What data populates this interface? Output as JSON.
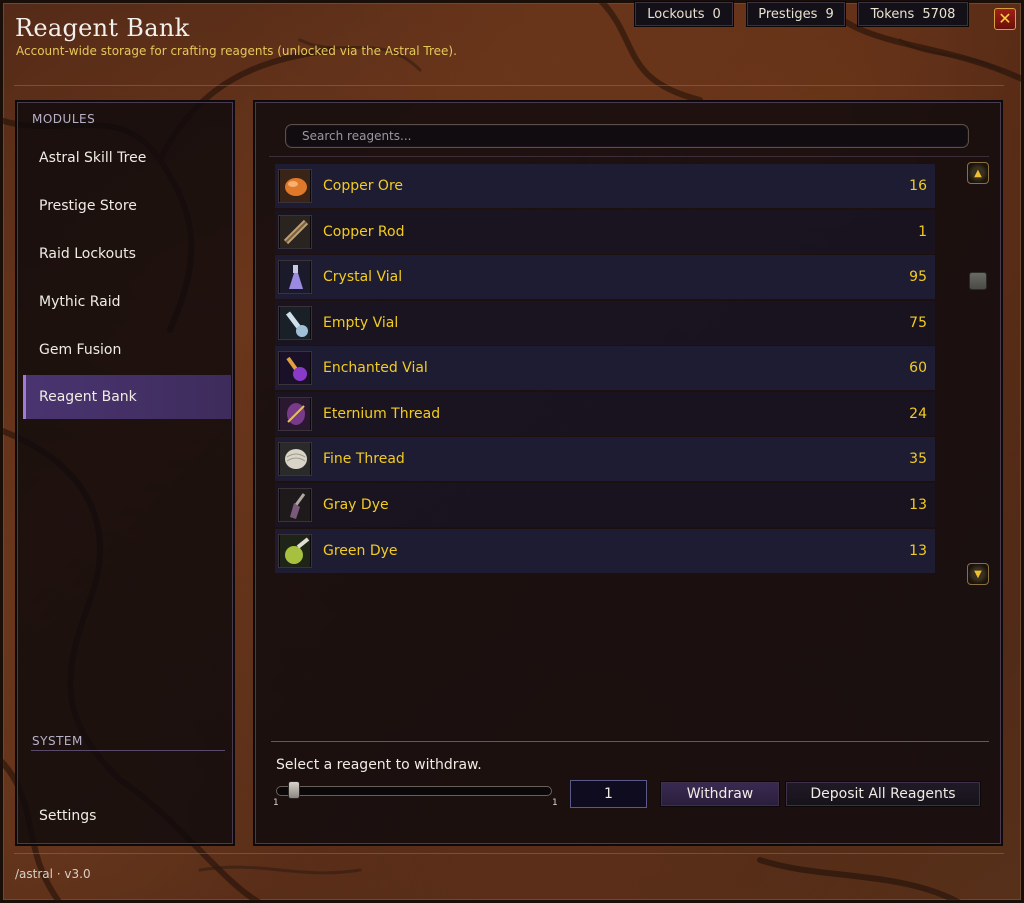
{
  "header": {
    "title": "Reagent Bank",
    "subtitle": "Account-wide storage for crafting reagents (unlocked via the Astral Tree)."
  },
  "stats": {
    "lockouts_label": "Lockouts",
    "lockouts_value": "0",
    "prestiges_label": "Prestiges",
    "prestiges_value": "9",
    "tokens_label": "Tokens",
    "tokens_value": "5708"
  },
  "close_glyph": "✕",
  "sidebar": {
    "modules_heading": "MODULES",
    "items": [
      {
        "label": "Astral Skill Tree"
      },
      {
        "label": "Prestige Store"
      },
      {
        "label": "Raid Lockouts"
      },
      {
        "label": "Mythic Raid"
      },
      {
        "label": "Gem Fusion"
      },
      {
        "label": "Reagent Bank",
        "active": true
      }
    ],
    "system_heading": "SYSTEM",
    "settings_label": "Settings"
  },
  "search": {
    "placeholder": "Search reagents..."
  },
  "reagents": [
    {
      "name": "Copper Ore",
      "qty": "16",
      "icon": "copper-ore-icon"
    },
    {
      "name": "Copper Rod",
      "qty": "1",
      "icon": "copper-rod-icon"
    },
    {
      "name": "Crystal Vial",
      "qty": "95",
      "icon": "crystal-vial-icon"
    },
    {
      "name": "Empty Vial",
      "qty": "75",
      "icon": "empty-vial-icon"
    },
    {
      "name": "Enchanted Vial",
      "qty": "60",
      "icon": "enchanted-vial-icon"
    },
    {
      "name": "Eternium Thread",
      "qty": "24",
      "icon": "eternium-thread-icon"
    },
    {
      "name": "Fine Thread",
      "qty": "35",
      "icon": "fine-thread-icon"
    },
    {
      "name": "Gray Dye",
      "qty": "13",
      "icon": "gray-dye-icon"
    },
    {
      "name": "Green Dye",
      "qty": "13",
      "icon": "green-dye-icon"
    }
  ],
  "withdraw": {
    "prompt": "Select a reagent to withdraw.",
    "slider_min": "1",
    "slider_max": "1",
    "amount": "1",
    "withdraw_label": "Withdraw",
    "deposit_label": "Deposit All Reagents"
  },
  "footer": {
    "text": "/astral · v3.0"
  },
  "colors": {
    "accent_gold": "#f2cc20",
    "accent_purple": "#a27ad6",
    "subtitle_gold": "#e6c85a"
  }
}
